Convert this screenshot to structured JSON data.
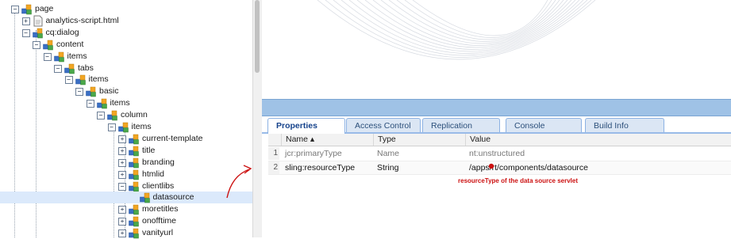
{
  "tree": {
    "nodes": [
      {
        "label": "page",
        "toggle": "−",
        "icon": "node"
      },
      {
        "label": "analytics-script.html",
        "toggle": "+",
        "icon": "file"
      },
      {
        "label": "cq:dialog",
        "toggle": "−",
        "icon": "node"
      },
      {
        "label": "content",
        "toggle": "−",
        "icon": "node"
      },
      {
        "label": "items",
        "toggle": "−",
        "icon": "node"
      },
      {
        "label": "tabs",
        "toggle": "−",
        "icon": "node"
      },
      {
        "label": "items",
        "toggle": "−",
        "icon": "node"
      },
      {
        "label": "basic",
        "toggle": "−",
        "icon": "node"
      },
      {
        "label": "items",
        "toggle": "−",
        "icon": "node"
      },
      {
        "label": "column",
        "toggle": "−",
        "icon": "node"
      },
      {
        "label": "items",
        "toggle": "−",
        "icon": "node"
      },
      {
        "label": "current-template",
        "toggle": "+",
        "icon": "node"
      },
      {
        "label": "title",
        "toggle": "+",
        "icon": "node"
      },
      {
        "label": "branding",
        "toggle": "+",
        "icon": "node"
      },
      {
        "label": "htmlid",
        "toggle": "+",
        "icon": "node"
      },
      {
        "label": "clientlibs",
        "toggle": "−",
        "icon": "node"
      },
      {
        "label": "datasource",
        "toggle": "",
        "icon": "node",
        "selected": true
      },
      {
        "label": "moretitles",
        "toggle": "+",
        "icon": "node"
      },
      {
        "label": "onofftime",
        "toggle": "+",
        "icon": "node"
      },
      {
        "label": "vanityurl",
        "toggle": "+",
        "icon": "node"
      }
    ]
  },
  "tabs": [
    "Properties",
    "Access Control",
    "Replication",
    "Console",
    "Build Info"
  ],
  "grid": {
    "headers": {
      "name": "Name ▴",
      "type": "Type",
      "value": "Value"
    },
    "rows": [
      {
        "num": "1",
        "name": "jcr:primaryType",
        "type": "Name",
        "value": "nt:unstructured",
        "muted": true
      },
      {
        "num": "2",
        "name": "sling:resourceType",
        "type": "String",
        "value": "/apps/rt/components/datasource",
        "muted": false
      }
    ]
  },
  "annotation": {
    "text": "resourceType of the data source servlet",
    "color": "#cc1111"
  },
  "colors": {
    "selection": "#dbe9fb",
    "tab_border": "#8db2e3",
    "splitter": "#9fc2e6",
    "annotation": "#cc1111"
  }
}
